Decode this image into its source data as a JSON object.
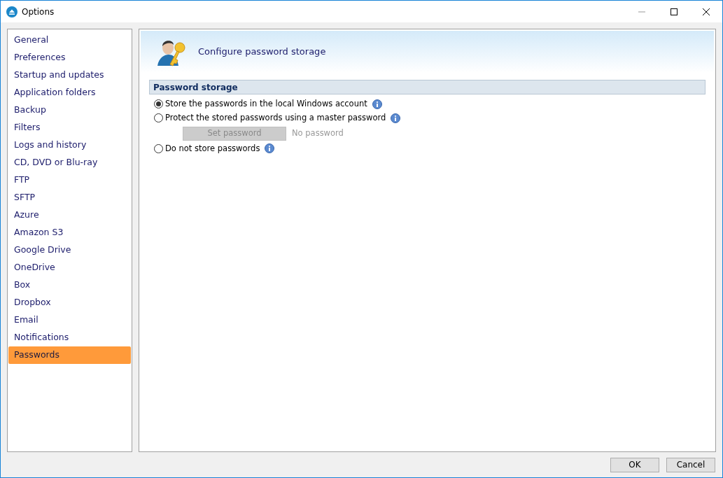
{
  "window": {
    "title": "Options"
  },
  "sidebar": {
    "items": [
      {
        "label": "General",
        "selected": false
      },
      {
        "label": "Preferences",
        "selected": false
      },
      {
        "label": "Startup and updates",
        "selected": false
      },
      {
        "label": "Application folders",
        "selected": false
      },
      {
        "label": "Backup",
        "selected": false
      },
      {
        "label": "Filters",
        "selected": false
      },
      {
        "label": "Logs and history",
        "selected": false
      },
      {
        "label": "CD, DVD or Blu-ray",
        "selected": false
      },
      {
        "label": "FTP",
        "selected": false
      },
      {
        "label": "SFTP",
        "selected": false
      },
      {
        "label": "Azure",
        "selected": false
      },
      {
        "label": "Amazon S3",
        "selected": false
      },
      {
        "label": "Google Drive",
        "selected": false
      },
      {
        "label": "OneDrive",
        "selected": false
      },
      {
        "label": "Box",
        "selected": false
      },
      {
        "label": "Dropbox",
        "selected": false
      },
      {
        "label": "Email",
        "selected": false
      },
      {
        "label": "Notifications",
        "selected": false
      },
      {
        "label": "Passwords",
        "selected": true
      }
    ]
  },
  "header": {
    "title": "Configure password storage"
  },
  "section": {
    "title": "Password storage",
    "options": [
      {
        "label": "Store the passwords in the local Windows account",
        "selected": true
      },
      {
        "label": "Protect the stored passwords using a master password",
        "selected": false,
        "button": {
          "label": "Set password",
          "disabled": true
        },
        "status": "No password"
      },
      {
        "label": "Do not store passwords",
        "selected": false
      }
    ]
  },
  "buttons": [
    "OK",
    "Cancel"
  ]
}
